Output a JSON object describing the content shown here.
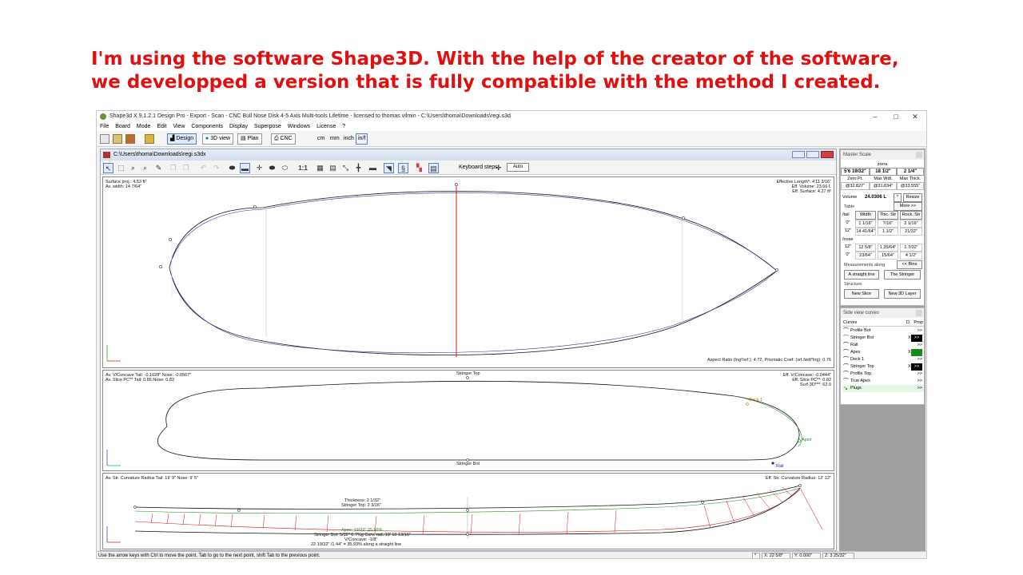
{
  "headline": {
    "line1": "I'm using the software Shape3D. With the help of the creator of the software,",
    "line2": "we developped a version that is fully compatible with the method I created."
  },
  "window": {
    "title": "Shape3d X 9.1.2.1 Design Pro - Export - Scan - CNC Bull Nose Disk 4-5 Axis Multi-tools Lifetime - licensed to thomas vilmin - C:\\Users\\thoma\\Downloads\\regi.s3d",
    "minimize": "–",
    "maximize": "□",
    "close": "✕"
  },
  "menu": [
    "File",
    "Board",
    "Mode",
    "Edit",
    "View",
    "Components",
    "Display",
    "Superpose",
    "Windows",
    "License",
    "?"
  ],
  "toolbar": {
    "design": "Design",
    "view3d": "3D view",
    "plan": "Plan",
    "cnc": "CNC",
    "units": [
      "cm",
      "mm",
      "inch",
      "in/f"
    ],
    "active_unit": "in/f"
  },
  "doc": {
    "title": "C:\\Users\\thoma\\Downloads\\regi.s3dx",
    "scale_label": "1:1",
    "keyboard_label": "Keyboard steps",
    "keyboard_value": "Auto"
  },
  "outline_pane": {
    "tl1": "Surface proj.: 4.53 ft²",
    "tl2": "Av. width: 14 7/64\"",
    "tr1": "Effective Length*: 4'11 3/16\"",
    "tr2": "Eff. Volume: 23.66 L",
    "tr3": "Eff. Surface: 4.27 ft²",
    "br": "Aspect Ratio (lng²/srf.): 4.72, Prismatic Coef. (srf./wdt*lng): 0.76"
  },
  "side_pane": {
    "tl1": "Av. V/Concave Tail: -0.1028\" Nose: -0.0567\"",
    "tl2": "Av. Slice PC** Tail: 0.86 Nose: 0.83",
    "tr1": "Eff. V/Concave: -0.0444\"",
    "tr2": "Eff. Slice PC**: 0.82",
    "tr3": "Surf-3D***: 62.0",
    "stringer_top": "Stringer Top",
    "stringer_bot": "Stringer Bot",
    "deck": "Deck 1",
    "apex": "Apex",
    "rail": "Rail"
  },
  "profile_pane": {
    "tl": "Av. Str. Curvature Radius Tail: 19' 9\" Nose: 9' 5\"",
    "tr": "Eff. Str. Curvature Radius: 12' 12\"",
    "thick1": "Thickness: 2 1/32\"",
    "thick2": "Stringer Top: 2 3/16\"",
    "apex_lbl": "Apex: 13/32\" 25.69%",
    "sb": "Stringer Bot: 5/32\" 6.7%g Curv. rad.:10' 10 13/16\"",
    "vc": "V/Concave: -1/8\"",
    "sl": "22 19/32\" /1 44\" = 35.93% along a straight line"
  },
  "master_scale": {
    "title": "Master Scale",
    "name": "zorra",
    "length": "5'6 19/32\"",
    "width": "18 1/2\"",
    "thick": "2 1/4\"",
    "zero_pt": "Zero Pt.",
    "max_wdt": "Max Wdt.",
    "max_thk": "Max Thick.",
    "zero_val": "@32.827\"",
    "wdt_val": "@31.834\"",
    "thk_val": "@33.555\"",
    "volume_label": "Volume",
    "volume": "24.0306 L",
    "star": "*",
    "resize": "Resize",
    "more": "More >>",
    "table_label": "Table",
    "tail_label": "/tail",
    "nose_label": "/nose",
    "col_width": "Width",
    "col_thic": "Thic. Str",
    "col_rock": "Rock. Str",
    "tail_rows": [
      [
        "0\"",
        "1 1/16\"",
        "7/16\"",
        "2 1/16\""
      ],
      [
        "12\"",
        "14 41/64\"",
        "1 1/2\"",
        "21/32\""
      ]
    ],
    "nose_rows": [
      [
        "12\"",
        "12 5/8\"",
        "1 35/64\"",
        "1 7/32\""
      ],
      [
        "0\"",
        "23/64\"",
        "15/64\"",
        "4 1/2\""
      ]
    ],
    "btns": "<< Btns",
    "meas_label": "Measurements along",
    "straight": "A straight line",
    "stringer": "The Stringer",
    "struct_label": "Structure",
    "new_slice": "New Slice",
    "new_layer": "New 3D Layer"
  },
  "curves_panel": {
    "title": "Side view curves",
    "h_curves": "Curves",
    "h_d": "D.",
    "h_prop": "Prop",
    "rows": [
      {
        "name": "Profile Bot",
        "x": "",
        "prop": ">>",
        "style": ""
      },
      {
        "name": "Stringer Bot",
        "x": "X",
        "prop": ">>",
        "style": "black"
      },
      {
        "name": "Rail",
        "x": "",
        "prop": ">>",
        "style": ""
      },
      {
        "name": "Apex",
        "x": "X",
        "prop": ">>",
        "style": "green"
      },
      {
        "name": "Deck 1",
        "x": "",
        "prop": ">>",
        "style": ""
      },
      {
        "name": "Stringer Top",
        "x": "X",
        "prop": ">>",
        "style": "black"
      },
      {
        "name": "Profile Top",
        "x": "",
        "prop": ">>",
        "style": ""
      },
      {
        "name": "True Apex",
        "x": "",
        "prop": ">>",
        "style": ""
      },
      {
        "name": "Plugs",
        "x": "",
        "prop": ">>",
        "style": "plugs"
      }
    ]
  },
  "status": {
    "hint": "Use the arrow keys with Ctrl to move the point, Tab to go to the next point, shift Tab to the previous point.",
    "star": "*",
    "x": "X: 22 5/8\"",
    "y": "Y: 0.000\"",
    "z": "Z: 3 25/32\""
  }
}
